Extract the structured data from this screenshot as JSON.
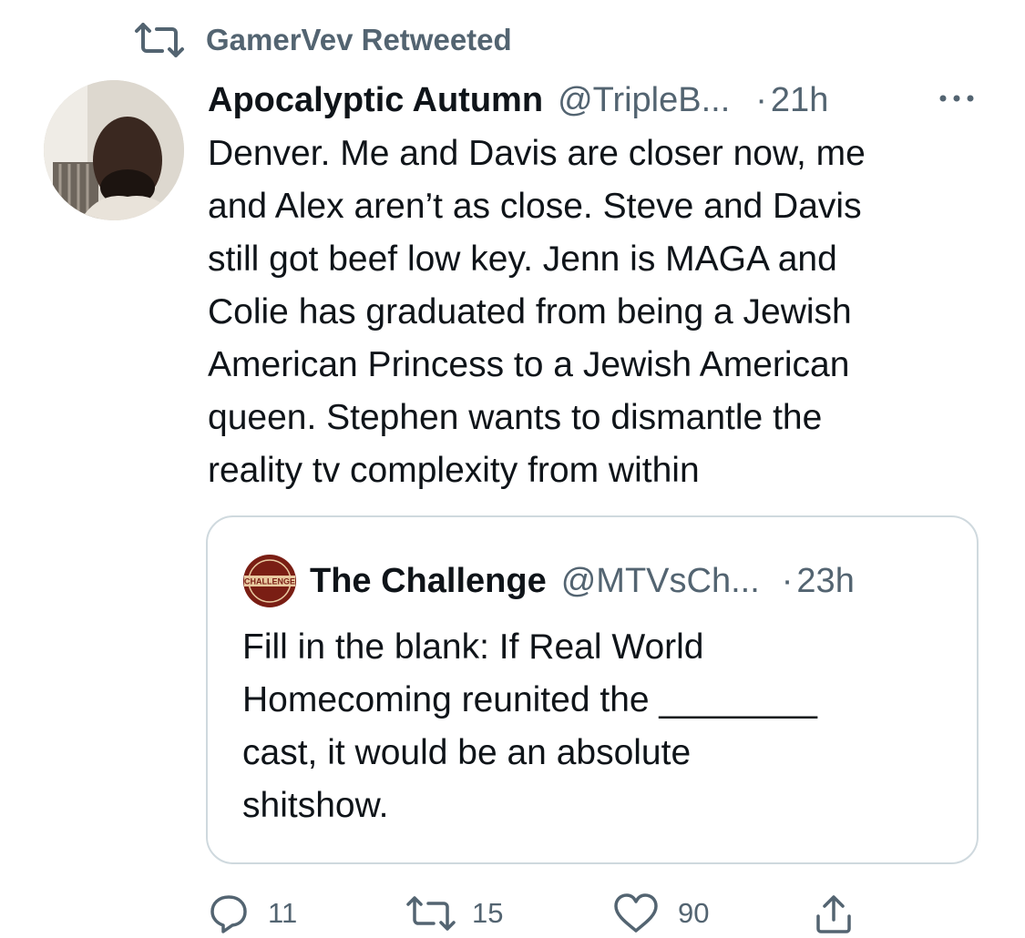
{
  "retweet_context": {
    "label": "GamerVev Retweeted",
    "icon": "retweet-icon"
  },
  "tweet": {
    "author_name": "Apocalyptic Autumn",
    "author_handle": "@TripleB...",
    "separator": "·",
    "time": "21h",
    "more_icon": "more-horizontal-icon",
    "text": "Denver. Me and Davis are closer now, me\nand Alex aren’t as close. Steve and Davis\nstill got beef low key. Jenn is MAGA and\nColie has graduated from being a Jewish\nAmerican Princess to a Jewish American\nqueen. Stephen wants to dismantle the\nreality tv complexity from within"
  },
  "quoted_tweet": {
    "author_name": "The Challenge",
    "author_handle": "@MTVsCh...",
    "separator": "·",
    "time": "23h",
    "avatar_logo_text": "CHALLENGE",
    "text": "Fill in the blank: If Real World\nHomecoming reunited the ________\ncast, it would be an absolute\nshitshow."
  },
  "actions": {
    "reply": {
      "icon": "reply-icon",
      "count": "11"
    },
    "retweet": {
      "icon": "retweet-icon",
      "count": "15"
    },
    "like": {
      "icon": "heart-icon",
      "count": "90"
    },
    "share": {
      "icon": "share-icon"
    }
  },
  "colors": {
    "text_primary": "#0f1419",
    "text_secondary": "#536471",
    "border": "#cfd9de"
  }
}
